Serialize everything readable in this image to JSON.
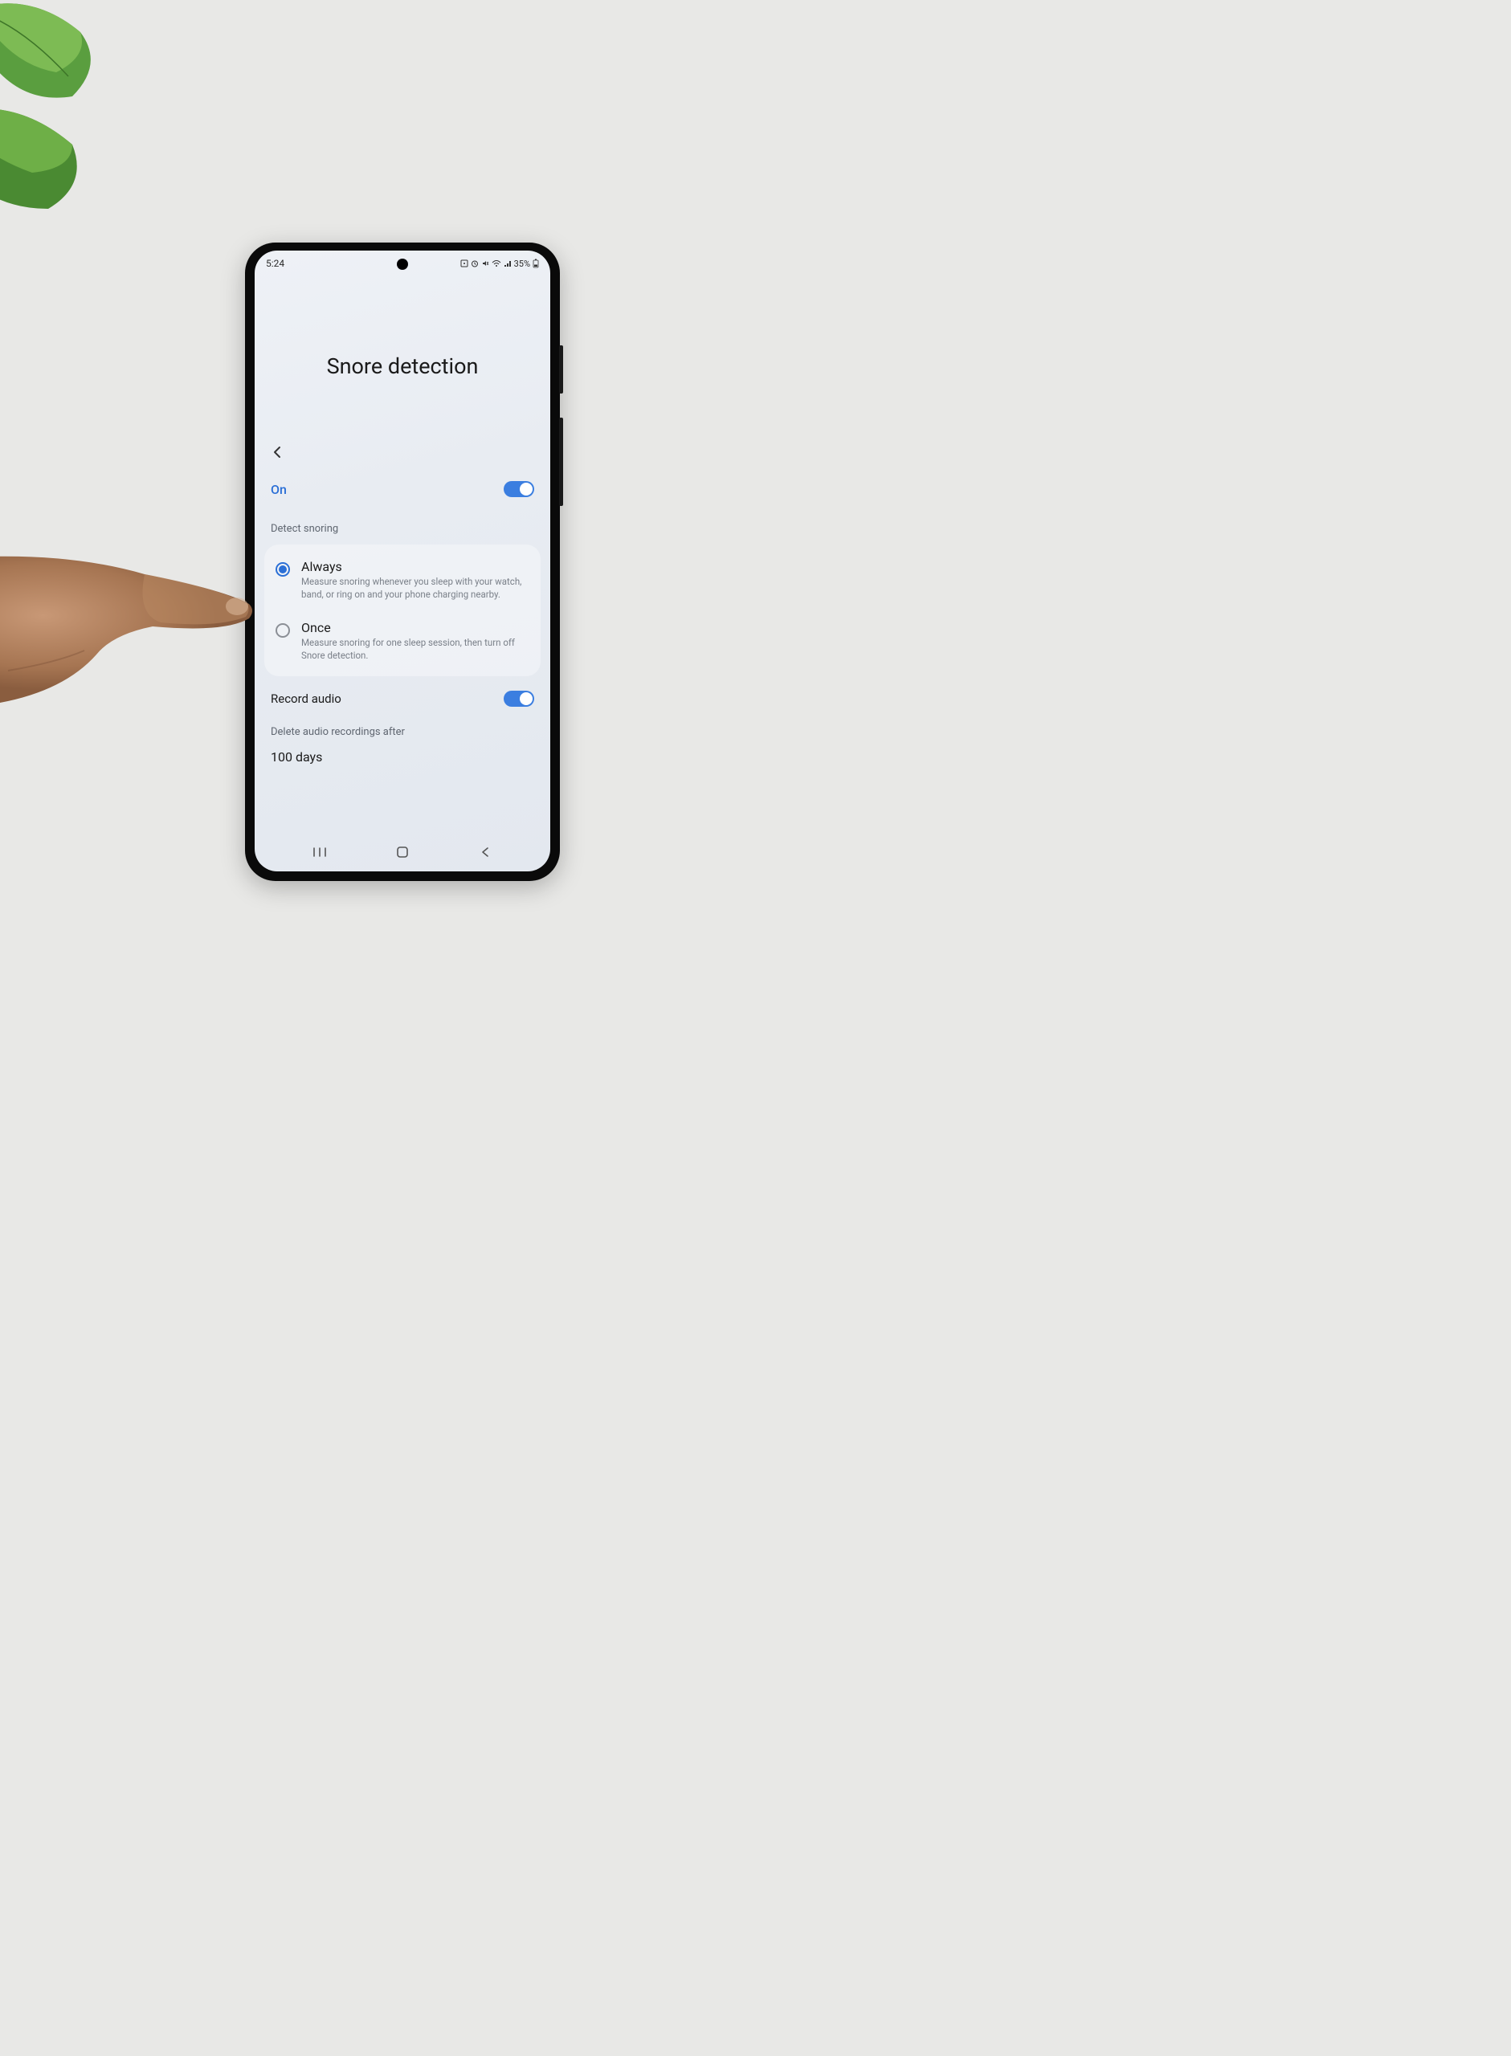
{
  "status": {
    "time": "5:24",
    "battery": "35%"
  },
  "page": {
    "title": "Snore detection"
  },
  "main_toggle": {
    "label": "On",
    "state": true
  },
  "detect_section": {
    "header": "Detect snoring",
    "options": [
      {
        "title": "Always",
        "description": "Measure snoring whenever you sleep with your watch, band, or ring on and your phone charging nearby.",
        "selected": true
      },
      {
        "title": "Once",
        "description": "Measure snoring for one sleep session, then turn off Snore detection.",
        "selected": false
      }
    ]
  },
  "record_audio": {
    "label": "Record audio",
    "state": true
  },
  "delete_section": {
    "header": "Delete audio recordings after",
    "value": "100 days"
  }
}
